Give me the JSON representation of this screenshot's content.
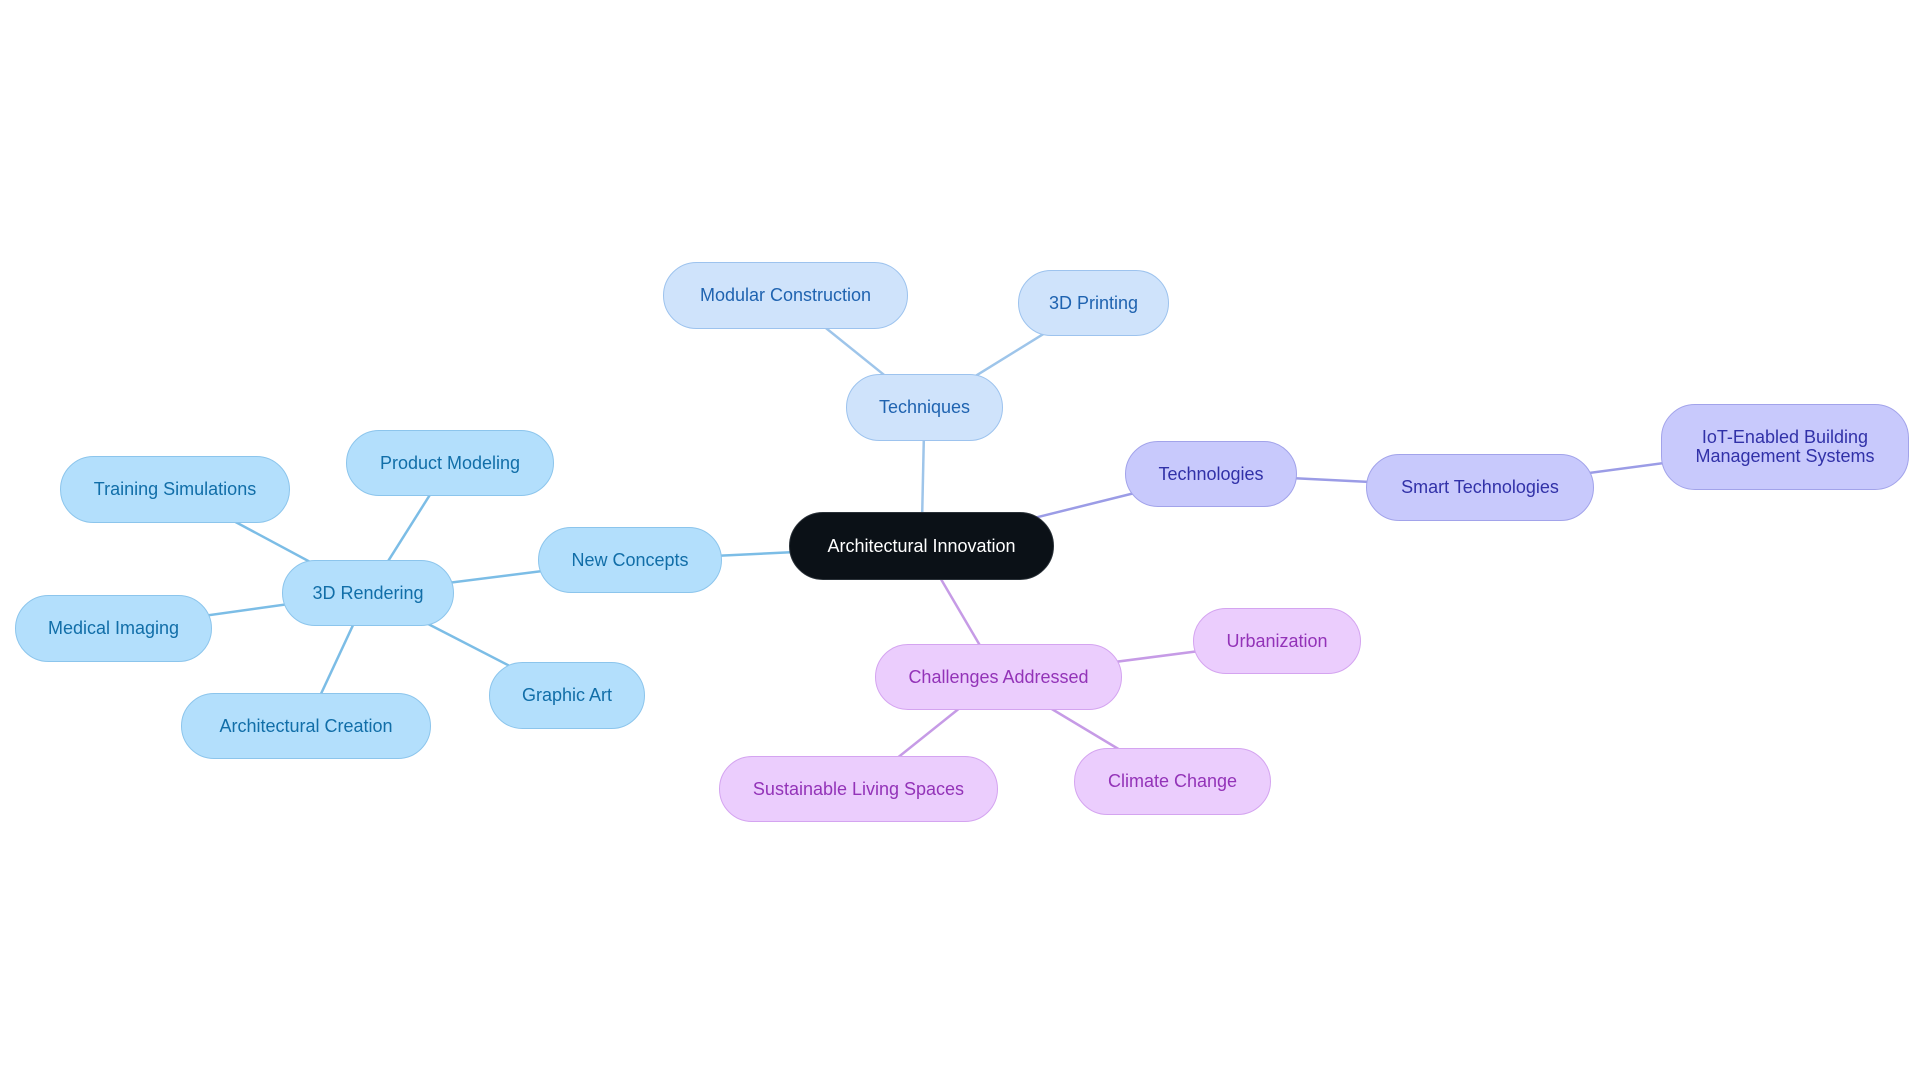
{
  "title": "Architectural Innovation",
  "colors": {
    "root_fill": "#0b1117",
    "techniques_edge": "#9ec5ea",
    "new_concepts_edge": "#7cbde6",
    "technologies_edge": "#9b9ce6",
    "challenges_edge": "#c69be6"
  },
  "nodes": {
    "root": "Architectural Innovation",
    "techniques": "Techniques",
    "modular_construction": "Modular Construction",
    "printing_3d": "3D Printing",
    "technologies": "Technologies",
    "smart_technologies": "Smart Technologies",
    "iot": "IoT-Enabled Building\nManagement Systems",
    "new_concepts": "New Concepts",
    "rendering_3d": "3D Rendering",
    "product_modeling": "Product Modeling",
    "training_simulations": "Training Simulations",
    "medical_imaging": "Medical Imaging",
    "architectural_creation": "Architectural Creation",
    "graphic_art": "Graphic Art",
    "challenges": "Challenges Addressed",
    "urbanization": "Urbanization",
    "climate_change": "Climate Change",
    "sustainable_living": "Sustainable Living Spaces"
  },
  "edges": [
    {
      "from": "root",
      "to": "techniques",
      "color": "techniques_edge"
    },
    {
      "from": "techniques",
      "to": "modular_construction",
      "color": "techniques_edge"
    },
    {
      "from": "techniques",
      "to": "printing_3d",
      "color": "techniques_edge"
    },
    {
      "from": "root",
      "to": "technologies",
      "color": "technologies_edge"
    },
    {
      "from": "technologies",
      "to": "smart_technologies",
      "color": "technologies_edge"
    },
    {
      "from": "smart_technologies",
      "to": "iot",
      "color": "technologies_edge"
    },
    {
      "from": "root",
      "to": "new_concepts",
      "color": "new_concepts_edge"
    },
    {
      "from": "new_concepts",
      "to": "rendering_3d",
      "color": "new_concepts_edge"
    },
    {
      "from": "rendering_3d",
      "to": "product_modeling",
      "color": "new_concepts_edge"
    },
    {
      "from": "rendering_3d",
      "to": "training_simulations",
      "color": "new_concepts_edge"
    },
    {
      "from": "rendering_3d",
      "to": "medical_imaging",
      "color": "new_concepts_edge"
    },
    {
      "from": "rendering_3d",
      "to": "architectural_creation",
      "color": "new_concepts_edge"
    },
    {
      "from": "rendering_3d",
      "to": "graphic_art",
      "color": "new_concepts_edge"
    },
    {
      "from": "root",
      "to": "challenges",
      "color": "challenges_edge"
    },
    {
      "from": "challenges",
      "to": "urbanization",
      "color": "challenges_edge"
    },
    {
      "from": "challenges",
      "to": "climate_change",
      "color": "challenges_edge"
    },
    {
      "from": "challenges",
      "to": "sustainable_living",
      "color": "challenges_edge"
    }
  ]
}
